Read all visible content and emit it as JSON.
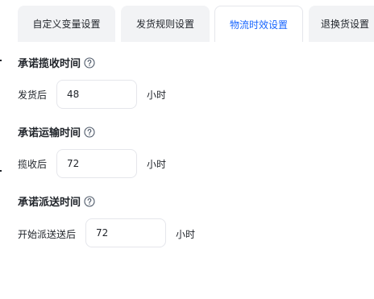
{
  "tabs": [
    {
      "label": "自定义变量设置"
    },
    {
      "label": "发货规则设置"
    },
    {
      "label": "物流时效设置"
    },
    {
      "label": "退换货设置"
    }
  ],
  "sections": [
    {
      "title": "承诺揽收时间",
      "label": "发货后",
      "value": "48",
      "unit": "小时"
    },
    {
      "title": "承诺运输时间",
      "label": "揽收后",
      "value": "72",
      "unit": "小时"
    },
    {
      "title": "承诺派送时间",
      "label": "开始派送送后",
      "value": "72",
      "unit": "小时"
    }
  ],
  "colors": {
    "accent": "#1966ff",
    "tab_bg": "#f2f3f5",
    "border": "#e5e6eb"
  },
  "icons": {
    "help": "question-circle-icon"
  }
}
